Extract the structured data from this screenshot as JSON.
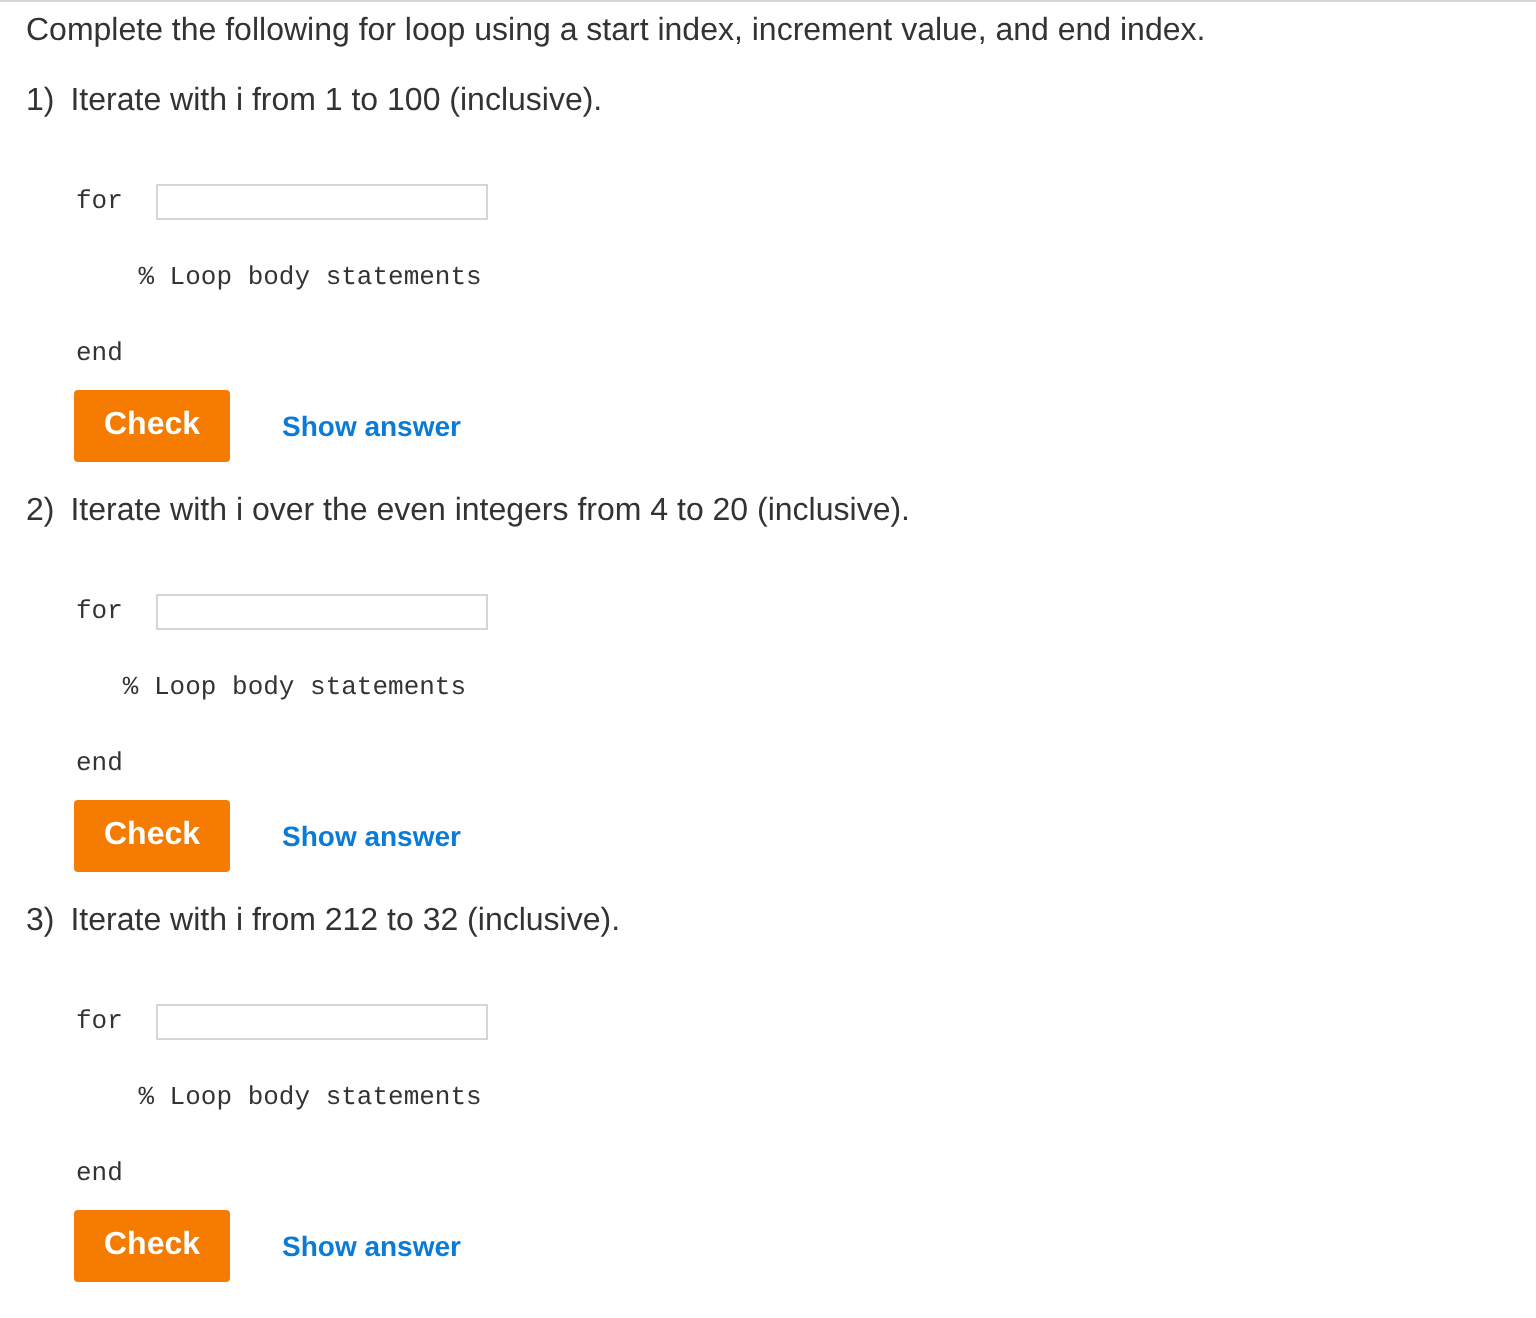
{
  "instructions": "Complete the following for loop using a start index, increment value, and end index.",
  "questions": [
    {
      "number": "1)",
      "prompt": "Iterate with i from 1 to 100 (inclusive).",
      "keyword_for": "for",
      "body": "    % Loop body statements",
      "keyword_end": "end",
      "check": "Check",
      "show_answer": "Show answer"
    },
    {
      "number": "2)",
      "prompt": "Iterate with i over the even integers from 4 to 20 (inclusive).",
      "keyword_for": "for",
      "body": "   % Loop body statements",
      "keyword_end": "end",
      "check": "Check",
      "show_answer": "Show answer"
    },
    {
      "number": "3)",
      "prompt": "Iterate with i from 212 to 32 (inclusive).",
      "keyword_for": "for",
      "body": "    % Loop body statements",
      "keyword_end": "end",
      "check": "Check",
      "show_answer": "Show answer"
    }
  ]
}
